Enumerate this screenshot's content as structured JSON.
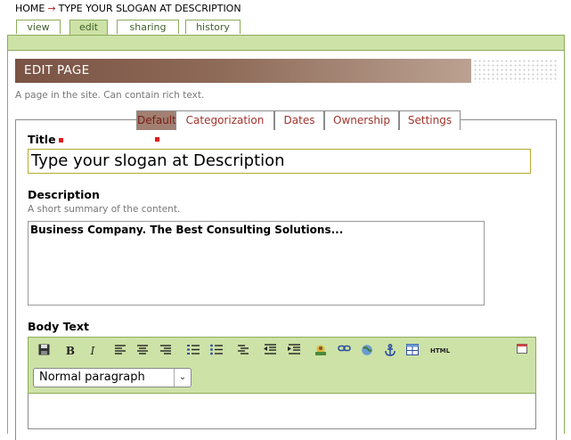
{
  "breadcrumb": {
    "home": "HOME",
    "arrow": "→",
    "current": "TYPE YOUR SLOGAN AT DESCRIPTION"
  },
  "view_tabs": [
    {
      "label": "view"
    },
    {
      "label": "edit"
    },
    {
      "label": "sharing"
    },
    {
      "label": "history"
    }
  ],
  "header": {
    "title": "EDIT PAGE",
    "subtitle": "A page in the site. Can contain rich text."
  },
  "form_tabs": [
    {
      "label": "Default"
    },
    {
      "label": "Categorization"
    },
    {
      "label": "Dates"
    },
    {
      "label": "Ownership"
    },
    {
      "label": "Settings"
    }
  ],
  "fields": {
    "title_label": "Title",
    "title_value": "Type your slogan at Description",
    "description_label": "Description",
    "description_help": "A short summary of the content.",
    "description_value": "Business Company. The Best Consulting Solutions...",
    "body_label": "Body Text"
  },
  "editor": {
    "format_select": "Normal paragraph",
    "html_button": "HTML",
    "bold_label": "B",
    "italic_label": "I",
    "chevron": "⌄"
  },
  "colors": {
    "accent_green": "#cde2a7",
    "border_green": "#8cac5b",
    "header_brown": "#7a5344",
    "link_red": "#a2322c"
  }
}
